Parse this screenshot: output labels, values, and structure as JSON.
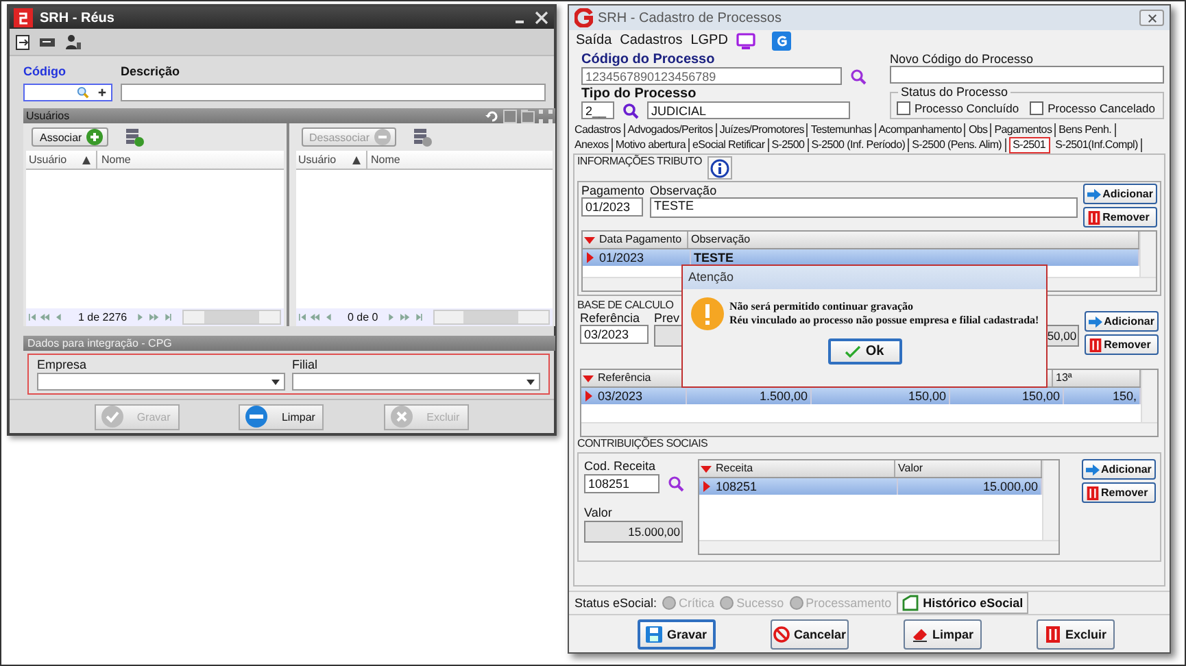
{
  "reus_window": {
    "title": "SRH - Réus",
    "codigo_label": "Código",
    "descricao_label": "Descrição",
    "usuarios_panel": {
      "title": "Usuários",
      "lists": [
        {
          "button": {
            "label": "Associar",
            "disabled": false
          },
          "columns": [
            "Usuário",
            "Nome"
          ],
          "pager": "1 de 2276"
        },
        {
          "button": {
            "label": "Desassociar",
            "disabled": true
          },
          "columns": [
            "Usuário",
            "Nome"
          ],
          "pager": "0 de 0"
        }
      ]
    },
    "integration_panel": {
      "title": "Dados para integração - CPG",
      "fields": [
        {
          "label": "Empresa"
        },
        {
          "label": "Filial"
        }
      ]
    },
    "buttons": [
      {
        "label": "Gravar",
        "disabled": true,
        "kind": "check"
      },
      {
        "label": "Limpar",
        "disabled": false,
        "kind": "minus"
      },
      {
        "label": "Excluir",
        "disabled": true,
        "kind": "cross"
      }
    ]
  },
  "processos_window": {
    "title": "SRH - Cadastro de Processos",
    "menu": [
      "Saída",
      "Cadastros",
      "LGPD"
    ],
    "codigo": {
      "label": "Código do Processo",
      "value": "1234567890123456789"
    },
    "novo_codigo": {
      "label": "Novo Código do Processo"
    },
    "tipo": {
      "label": "Tipo do Processo",
      "code": "2__",
      "description": "JUDICIAL"
    },
    "status_group": {
      "title": "Status do Processo",
      "options": [
        {
          "label": "Processo Concluído",
          "checked": false
        },
        {
          "label": "Processo Cancelado",
          "checked": false
        }
      ]
    },
    "tab_rows": [
      [
        {
          "label": "Cadastros",
          "selected": false
        },
        {
          "label": "Advogados/Peritos",
          "selected": false
        },
        {
          "label": "Juízes/Promotores",
          "selected": false
        },
        {
          "label": "Testemunhas",
          "selected": false
        },
        {
          "label": "Acompanhamento",
          "selected": false
        },
        {
          "label": "Obs",
          "selected": false
        },
        {
          "label": "Pagamentos",
          "selected": false
        },
        {
          "label": "Bens Penh.",
          "selected": false
        }
      ],
      [
        {
          "label": "Anexos",
          "selected": false
        },
        {
          "label": "Motivo abertura",
          "selected": false
        },
        {
          "label": "eSocial Retificar",
          "selected": false
        },
        {
          "label": "S-2500",
          "selected": false
        },
        {
          "label": "S-2500 (Inf. Período)",
          "selected": false
        },
        {
          "label": "S-2500 (Pens. Alim)",
          "selected": false
        },
        {
          "label": "S-2501",
          "selected": true
        },
        {
          "label": "S-2501(Inf.Compl)",
          "selected": false
        }
      ]
    ],
    "tributo": {
      "title": "INFORMAÇÕES TRIBUTO",
      "pagamento": {
        "label": "Pagamento",
        "value": "01/2023"
      },
      "observacao": {
        "label": "Observação",
        "value": "TESTE"
      },
      "buttons": [
        {
          "label": "Adicionar",
          "kind": "add"
        },
        {
          "label": "Remover",
          "kind": "remove"
        }
      ],
      "grid": {
        "columns": [
          "Data Pagamento",
          "Observação"
        ],
        "rows": [
          {
            "cells": [
              "01/2023",
              "TESTE"
            ],
            "selected": true
          }
        ]
      }
    },
    "base": {
      "title": "BASE DE CALCULO",
      "referencia": {
        "label": "Referência",
        "value": "03/2023"
      },
      "label_2": "Prev",
      "field_2_value": "50,00",
      "buttons": [
        {
          "label": "Adicionar",
          "kind": "add"
        },
        {
          "label": "Remover",
          "kind": "remove"
        }
      ],
      "grid": {
        "first_column": "Referência",
        "last_column": "13ª",
        "rows": [
          {
            "cells": [
              "03/2023",
              "1.500,00",
              "150,00",
              "150,00",
              "150,"
            ],
            "selected": true
          }
        ]
      }
    },
    "contribuicoes": {
      "title": "CONTRIBUIÇÕES SOCIAIS",
      "cod_receita": {
        "label": "Cod. Receita",
        "value": "108251"
      },
      "valor": {
        "label": "Valor",
        "value": "15.000,00"
      },
      "grid": {
        "columns": [
          "Receita",
          "Valor"
        ],
        "rows": [
          {
            "cells": [
              "108251",
              "15.000,00"
            ],
            "selected": true
          }
        ]
      },
      "buttons": [
        {
          "label": "Adicionar",
          "kind": "add"
        },
        {
          "label": "Remover",
          "kind": "remove"
        }
      ]
    },
    "status_bar": {
      "label": "Status eSocial:",
      "indicators": [
        {
          "label": "Crítica",
          "disabled": true
        },
        {
          "label": "Sucesso",
          "disabled": true
        },
        {
          "label": "Processamento",
          "disabled": true
        }
      ],
      "history_button": "Histórico eSocial"
    },
    "buttons": [
      {
        "label": "Gravar",
        "kind": "save"
      },
      {
        "label": "Cancelar",
        "kind": "cancel"
      },
      {
        "label": "Limpar",
        "kind": "eraser"
      },
      {
        "label": "Excluir",
        "kind": "delete"
      }
    ]
  },
  "dialog": {
    "title": "Atenção",
    "lines": [
      "Não será permitido continuar gravação",
      "Réu vinculado ao processo não possue empresa e filial cadastrada!"
    ],
    "button": "Ok"
  }
}
